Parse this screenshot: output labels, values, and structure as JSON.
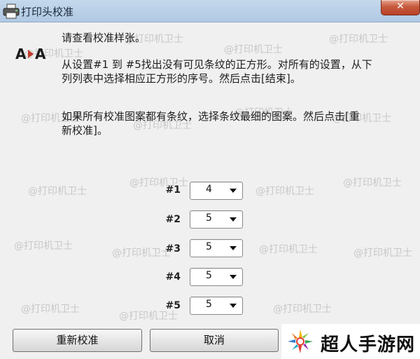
{
  "window": {
    "title": "打印头校准",
    "close_glyph": "✕"
  },
  "instructions": {
    "heading": "请查看校准样张。",
    "para1_line1": "从设置#1 到 #5找出没有可见条纹的正方形。对所有的设置，从下",
    "para1_line2": "列列表中选择相应正方形的序号。然后点击[结束]。",
    "para2_line1": "如果所有校准图案都有条纹，选择条纹最细的图案。然后点击[重",
    "para2_line2": "新校准]。"
  },
  "icon_label": {
    "a_left": "A",
    "a_right": "A"
  },
  "settings": [
    {
      "label": "#1",
      "value": "4"
    },
    {
      "label": "#2",
      "value": "5"
    },
    {
      "label": "#3",
      "value": "5"
    },
    {
      "label": "#4",
      "value": "5"
    },
    {
      "label": "#5",
      "value": "5"
    }
  ],
  "buttons": {
    "recalibrate": "重新校准",
    "cancel": "取消"
  },
  "watermark": "@打印机卫士",
  "brand": {
    "name": "超人手游网"
  }
}
